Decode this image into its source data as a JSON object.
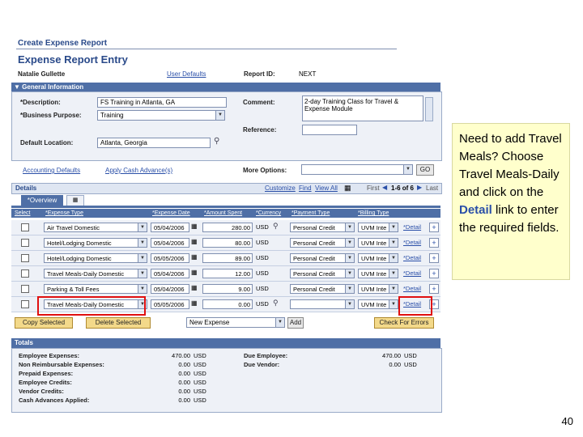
{
  "page": {
    "title": "Create Expense Report",
    "heading": "Expense Report Entry",
    "user_name": "Natalie Gullette",
    "user_defaults_link": "User Defaults",
    "report_id_label": "Report ID:",
    "report_id_value": "NEXT"
  },
  "general_info": {
    "section_title": "General Information",
    "description_label": "*Description:",
    "description_value": "FS Training in Atlanta, GA",
    "business_purpose_label": "*Business Purpose:",
    "business_purpose_value": "Training",
    "default_location_label": "Default Location:",
    "default_location_value": "Atlanta, Georgia",
    "comment_label": "Comment:",
    "comment_value": "2-day Training Class for Travel & Expense Module",
    "reference_label": "Reference:",
    "accounting_defaults_link": "Accounting Defaults",
    "apply_cash_advance_link": "Apply Cash Advance(s)",
    "more_options_label": "More Options:",
    "go_button": "GO"
  },
  "details": {
    "title": "Details",
    "customize": "Customize",
    "find": "Find",
    "view_all": "View All",
    "first": "First",
    "range": "1-6 of 6",
    "last": "Last",
    "tab_overview": "*Overview",
    "columns": [
      "Select",
      "*Expense Type",
      "*Expense Date",
      "*Amount Spent",
      "*Currency",
      "*Payment Type",
      "*Billing Type"
    ],
    "detail_link": "*Detail",
    "rows": [
      {
        "expense_type": "Air Travel Domestic",
        "date": "05/04/2006",
        "amount": "280.00",
        "currency": "USD",
        "payment": "Personal Credit",
        "billing": "UVM Inte"
      },
      {
        "expense_type": "Hotel/Lodging Domestic",
        "date": "05/04/2006",
        "amount": "80.00",
        "currency": "USD",
        "payment": "Personal Credit",
        "billing": "UVM Inte"
      },
      {
        "expense_type": "Hotel/Lodging Domestic",
        "date": "05/05/2006",
        "amount": "89.00",
        "currency": "USD",
        "payment": "Personal Credit",
        "billing": "UVM Inte"
      },
      {
        "expense_type": "Travel Meals-Daily Domestic",
        "date": "05/04/2006",
        "amount": "12.00",
        "currency": "USD",
        "payment": "Personal Credit",
        "billing": "UVM Inte"
      },
      {
        "expense_type": "Parking & Toll Fees",
        "date": "05/04/2006",
        "amount": "9.00",
        "currency": "USD",
        "payment": "Personal Credit",
        "billing": "UVM Inte"
      },
      {
        "expense_type": "Travel Meals-Daily Domestic",
        "date": "05/05/2006",
        "amount": "0.00",
        "currency": "USD",
        "payment": "",
        "billing": "UVM Inte"
      }
    ],
    "copy_selected": "Copy Selected",
    "delete_selected": "Delete Selected",
    "new_expense": "New Expense",
    "add": "Add",
    "check_for_errors": "Check For Errors"
  },
  "totals": {
    "title": "Totals",
    "left": [
      {
        "label": "Employee Expenses:",
        "amount": "470.00",
        "cur": "USD"
      },
      {
        "label": "Non Reimbursable Expenses:",
        "amount": "0.00",
        "cur": "USD"
      },
      {
        "label": "Prepaid Expenses:",
        "amount": "0.00",
        "cur": "USD"
      },
      {
        "label": "Employee Credits:",
        "amount": "0.00",
        "cur": "USD"
      },
      {
        "label": "Vendor Credits:",
        "amount": "0.00",
        "cur": "USD"
      },
      {
        "label": "Cash Advances Applied:",
        "amount": "0.00",
        "cur": "USD"
      }
    ],
    "right": [
      {
        "label": "Due Employee:",
        "amount": "470.00",
        "cur": "USD"
      },
      {
        "label": "Due Vendor:",
        "amount": "0.00",
        "cur": "USD"
      }
    ]
  },
  "callout": {
    "line1": "Need to add Travel Meals? Choose Travel Meals-Daily and click on the",
    "detail_word": "Detail",
    "line2": "link to enter the required fields."
  },
  "slide_number": "40",
  "colors": {
    "highlight_box": "#e01010",
    "header_blue": "#4f6fa6",
    "link_blue": "#2a4fa8",
    "callout_bg": "#ffffcc"
  }
}
